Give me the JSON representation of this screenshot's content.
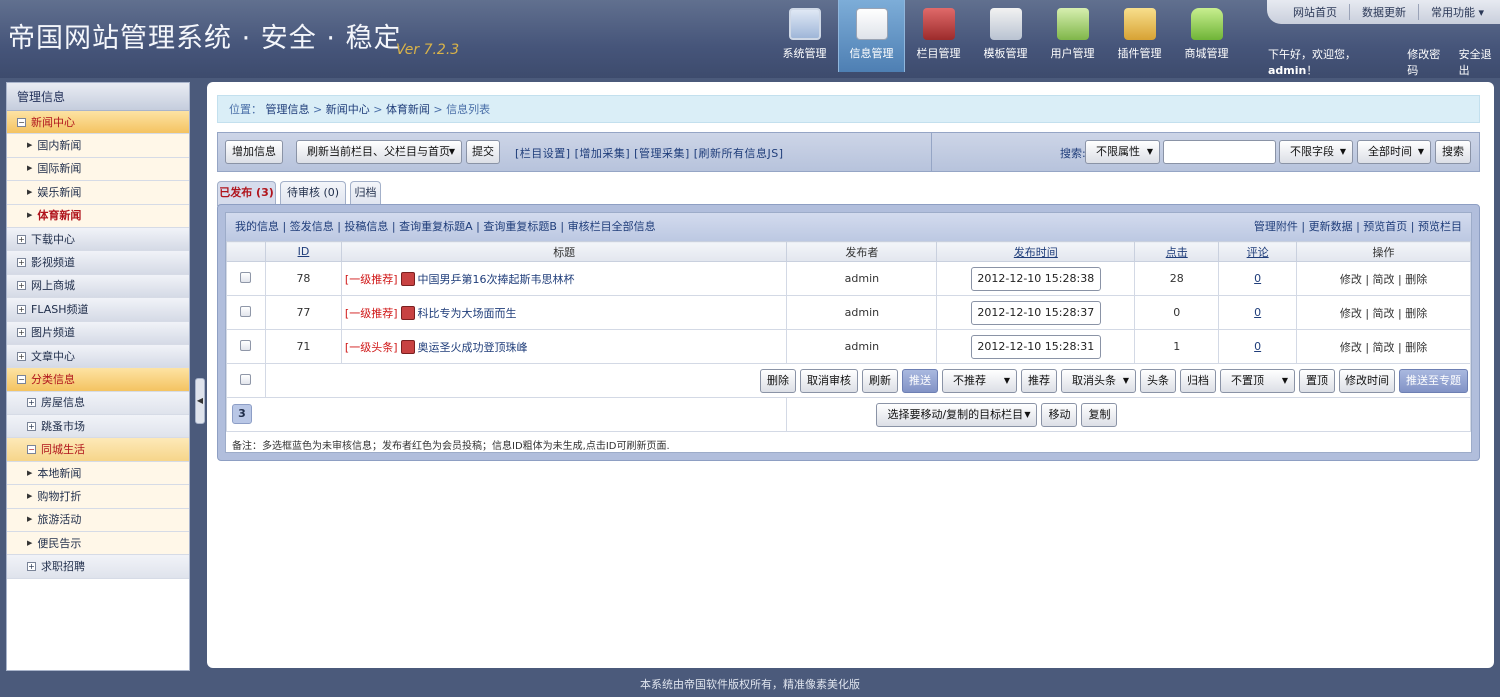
{
  "header": {
    "logo": "帝国网站管理系统 · 安全 · 稳定",
    "version": "Ver 7.2.3",
    "nav": [
      {
        "label": "系统管理",
        "icon": "monitor-icon"
      },
      {
        "label": "信息管理",
        "icon": "notepad-icon"
      },
      {
        "label": "栏目管理",
        "icon": "book-icon"
      },
      {
        "label": "模板管理",
        "icon": "document-icon"
      },
      {
        "label": "用户管理",
        "icon": "cabinet-icon"
      },
      {
        "label": "插件管理",
        "icon": "box-icon"
      },
      {
        "label": "商城管理",
        "icon": "shopping-bag-icon"
      }
    ],
    "active_nav": "信息管理",
    "top_links": [
      "网站首页",
      "数据更新",
      "常用功能 ▾"
    ],
    "welcome_prefix": "下午好，欢迎您，",
    "username": "admin",
    "welcome_suffix": "！",
    "change_password": "修改密码",
    "logout": "安全退出"
  },
  "sidebar": {
    "title": "管理信息",
    "items": [
      {
        "label": "新闻中心",
        "kind": "cat",
        "open": true
      },
      {
        "label": "国内新闻",
        "kind": "sub"
      },
      {
        "label": "国际新闻",
        "kind": "sub"
      },
      {
        "label": "娱乐新闻",
        "kind": "sub"
      },
      {
        "label": "体育新闻",
        "kind": "sub",
        "active": true
      },
      {
        "label": "下载中心",
        "kind": "cat"
      },
      {
        "label": "影视频道",
        "kind": "cat"
      },
      {
        "label": "网上商城",
        "kind": "cat"
      },
      {
        "label": "FLASH频道",
        "kind": "cat"
      },
      {
        "label": "图片频道",
        "kind": "cat"
      },
      {
        "label": "文章中心",
        "kind": "cat"
      },
      {
        "label": "分类信息",
        "kind": "cat",
        "open": true
      },
      {
        "label": "房屋信息",
        "kind": "subcat"
      },
      {
        "label": "跳蚤市场",
        "kind": "subcat"
      },
      {
        "label": "同城生活",
        "kind": "subcat",
        "open": true
      },
      {
        "label": "本地新闻",
        "kind": "sub"
      },
      {
        "label": "购物打折",
        "kind": "sub"
      },
      {
        "label": "旅游活动",
        "kind": "sub"
      },
      {
        "label": "便民告示",
        "kind": "sub"
      },
      {
        "label": "求职招聘",
        "kind": "subcat"
      }
    ]
  },
  "breadcrumb": {
    "prefix": "位置：",
    "parts": [
      "管理信息",
      "新闻中心",
      "体育新闻"
    ],
    "current": "信息列表"
  },
  "toolbar": {
    "add_info": "增加信息",
    "refresh_select": "刷新当前栏目、父栏目与首页",
    "submit": "提交",
    "links": "[栏目设置] [增加采集] [管理采集] [刷新所有信息JS]",
    "search_label": "搜索:",
    "attr_select": "不限属性",
    "field_select": "不限字段",
    "time_select": "全部时间",
    "search_button": "搜索",
    "search_value": ""
  },
  "tabs": [
    {
      "label": "已发布 (3)",
      "active": true
    },
    {
      "label": "待审核 (0)"
    },
    {
      "label": "归档"
    }
  ],
  "list": {
    "head_links": "我的信息 | 签发信息 | 投稿信息 | 查询重复标题A | 查询重复标题B | 审核栏目全部信息",
    "head_right": "管理附件 | 更新数据 | 预览首页 | 预览栏目",
    "columns": [
      "ID",
      "标题",
      "发布者",
      "发布时间",
      "点击",
      "评论",
      "操作"
    ],
    "rows": [
      {
        "id": "78",
        "tag": "[一级推荐]",
        "title": "中国男乒第16次捧起斯韦思林杯",
        "author": "admin",
        "time": "2012-12-10 15:28:38",
        "clicks": "28",
        "comments": "0",
        "ops": "修改 | 简改 | 删除"
      },
      {
        "id": "77",
        "tag": "[一级推荐]",
        "title": "科比专为大场面而生",
        "author": "admin",
        "time": "2012-12-10 15:28:37",
        "clicks": "0",
        "comments": "0",
        "ops": "修改 | 简改 | 删除"
      },
      {
        "id": "71",
        "tag": "[一级头条]",
        "title": "奥运圣火成功登顶珠峰",
        "author": "admin",
        "time": "2012-12-10 15:28:31",
        "clicks": "1",
        "comments": "0",
        "ops": "修改 | 简改 | 删除"
      }
    ],
    "actions": {
      "delete": "删除",
      "cancel_review": "取消审核",
      "refresh": "刷新",
      "push": "推送",
      "no_recommend": "不推荐",
      "recommend": "推荐",
      "cancel_headline": "取消头条",
      "headline": "头条",
      "archive": "归档",
      "no_top": "不置顶",
      "top": "置顶",
      "change_time": "修改时间",
      "push_to_topic": "推送至专题"
    },
    "total_badge": "3",
    "move_select": "选择要移动/复制的目标栏目",
    "move": "移动",
    "copy": "复制",
    "note": "备注：多选框蓝色为未审核信息；发布者红色为会员投稿；信息ID粗体为未生成,点击ID可刷新页面."
  },
  "footer": "本系统由帝国软件版权所有，精准像素美化版"
}
